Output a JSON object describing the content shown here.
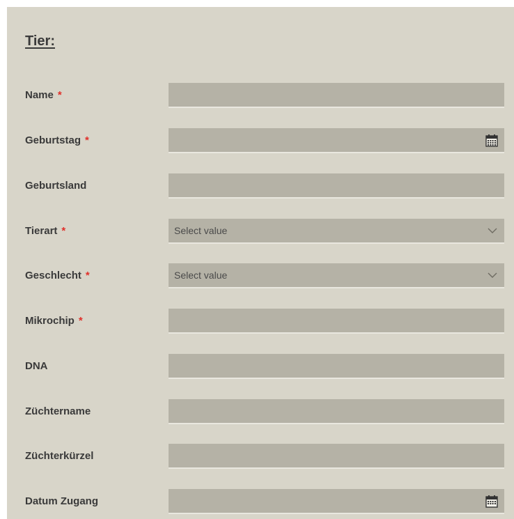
{
  "form": {
    "section_title": "Tier:",
    "required_mark": "*",
    "select_placeholder": "Select value",
    "fields": [
      {
        "label": "Name",
        "required": true,
        "type": "text",
        "value": ""
      },
      {
        "label": "Geburtstag",
        "required": true,
        "type": "date",
        "value": "",
        "icon": "calendar-icon"
      },
      {
        "label": "Geburtsland",
        "required": false,
        "type": "text",
        "value": ""
      },
      {
        "label": "Tierart",
        "required": true,
        "type": "select",
        "value": "Select value",
        "icon": "chevron-down-icon"
      },
      {
        "label": "Geschlecht",
        "required": true,
        "type": "select",
        "value": "Select value",
        "icon": "chevron-down-icon"
      },
      {
        "label": "Mikrochip",
        "required": true,
        "type": "text",
        "value": ""
      },
      {
        "label": "DNA",
        "required": false,
        "type": "text",
        "value": ""
      },
      {
        "label": "Züchtername",
        "required": false,
        "type": "text",
        "value": ""
      },
      {
        "label": "Züchterkürzel",
        "required": false,
        "type": "text",
        "value": ""
      },
      {
        "label": "Datum Zugang",
        "required": false,
        "type": "date",
        "value": "",
        "icon": "calendar-icon"
      }
    ]
  },
  "colors": {
    "panel_background": "#d8d5c9",
    "field_background": "#b5b2a6",
    "required_marker": "#e0302a"
  }
}
